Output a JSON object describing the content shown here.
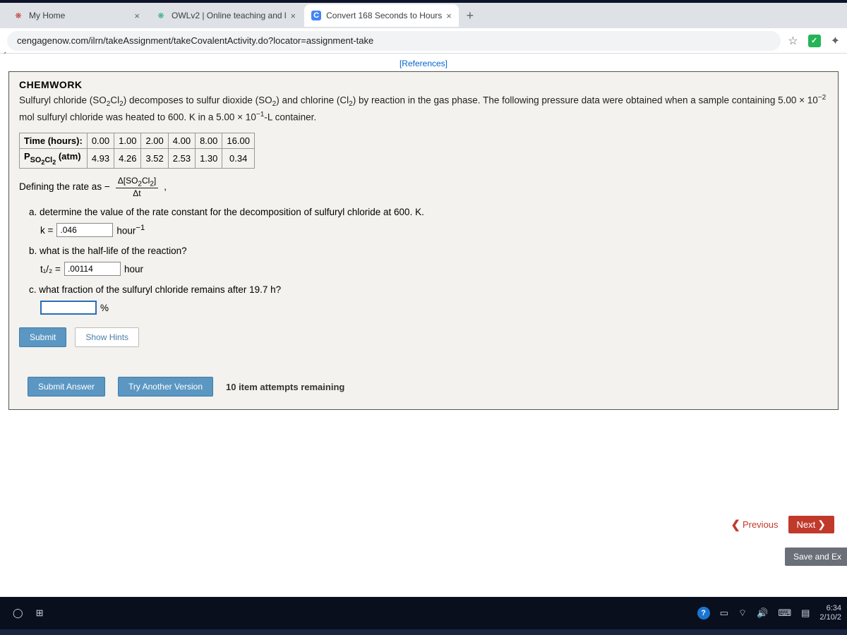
{
  "tabs": [
    {
      "title": "My Home",
      "favicon": "❋"
    },
    {
      "title": "OWLv2 | Online teaching and l",
      "favicon": "❋"
    },
    {
      "title": "Convert 168 Seconds to Hours",
      "favicon": "C"
    }
  ],
  "new_tab": "+",
  "close_glyph": "×",
  "url": "cengagenow.com/ilrn/takeAssignment/takeCovalentActivity.do?locator=assignment-take",
  "star": "☆",
  "references_link": "[References]",
  "chemwork": "CHEMWORK",
  "intro_html": "Sulfuryl chloride (SO<sub>2</sub>Cl<sub>2</sub>) decomposes to sulfur dioxide (SO<sub>2</sub>) and chlorine (Cl<sub>2</sub>) by reaction in the gas phase. The following pressure data were obtained when a sample containing 5.00 × 10<sup>−2</sup> mol sulfuryl chloride was heated to 600. K in a 5.00 × 10<sup>−1</sup>-L container.",
  "table": {
    "row1_label": "Time (hours):",
    "row2_label_html": "P<sub>SO<sub>2</sub>Cl<sub>2</sub></sub> (atm)",
    "times": [
      "0.00",
      "1.00",
      "2.00",
      "4.00",
      "8.00",
      "16.00"
    ],
    "pressures": [
      "4.93",
      "4.26",
      "3.52",
      "2.53",
      "1.30",
      "0.34"
    ]
  },
  "rate_def_prefix": "Defining the rate as −",
  "rate_num_html": "Δ[SO<sub>2</sub>Cl<sub>2</sub>]",
  "rate_den": "Δt",
  "rate_suffix": ",",
  "qa_text": "a. determine the value of the rate constant for the decomposition of sulfuryl chloride at 600. K.",
  "qa_k": "k =",
  "qa_k_val": ".046",
  "qa_k_unit_html": "hour<sup>−1</sup>",
  "qb_text": "b. what is the half-life of the reaction?",
  "qb_t": "t₁/₂ =",
  "qb_t_val": ".00114",
  "qb_unit": "hour",
  "qc_text": "c. what fraction of the sulfuryl chloride remains after 19.7 h?",
  "qc_val": "",
  "qc_unit": "%",
  "submit": "Submit",
  "show_hints": "Show Hints",
  "submit_answer": "Submit Answer",
  "try_another": "Try Another Version",
  "attempts": "10 item attempts remaining",
  "prev": "Previous",
  "next": "Next",
  "save_exit": "Save and Ex",
  "clock_time": "6:34",
  "clock_date": "2/10/2"
}
